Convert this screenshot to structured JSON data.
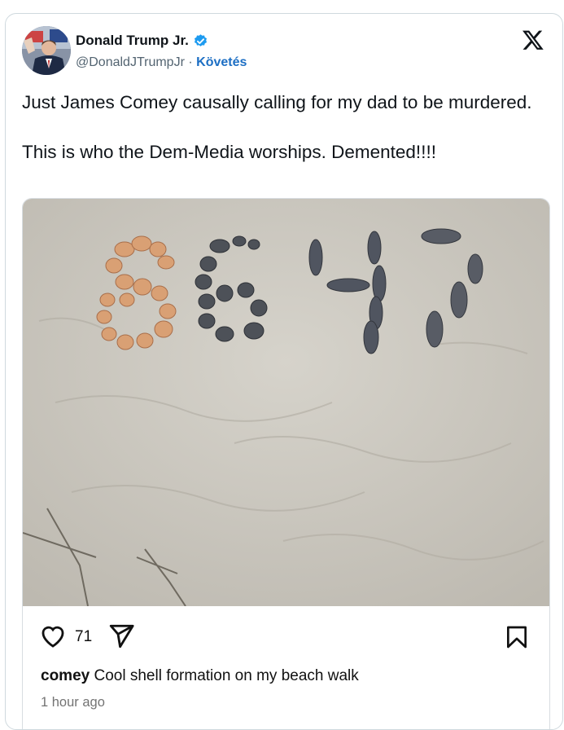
{
  "author": {
    "name": "Donald Trump Jr.",
    "handle": "@DonaldJTrumpJr",
    "separator": "·",
    "follow_label": "Követés"
  },
  "tweet": {
    "paragraphs": [
      "Just James Comey causally calling for my dad to be murdered.",
      "This is who the Dem-Media worships. Demented!!!!"
    ]
  },
  "embedded_post": {
    "image_alt": "8647",
    "likes": "71",
    "caption_user": "comey",
    "caption_text": "Cool shell formation on my beach walk",
    "time": "1 hour ago"
  },
  "colors": {
    "verified_blue": "#1d9bf0",
    "link_blue": "#1d6fc4",
    "sand": "#cfccc3"
  },
  "icons": [
    "verified-badge-icon",
    "x-logo-icon",
    "heart-icon",
    "send-icon",
    "bookmark-icon"
  ]
}
